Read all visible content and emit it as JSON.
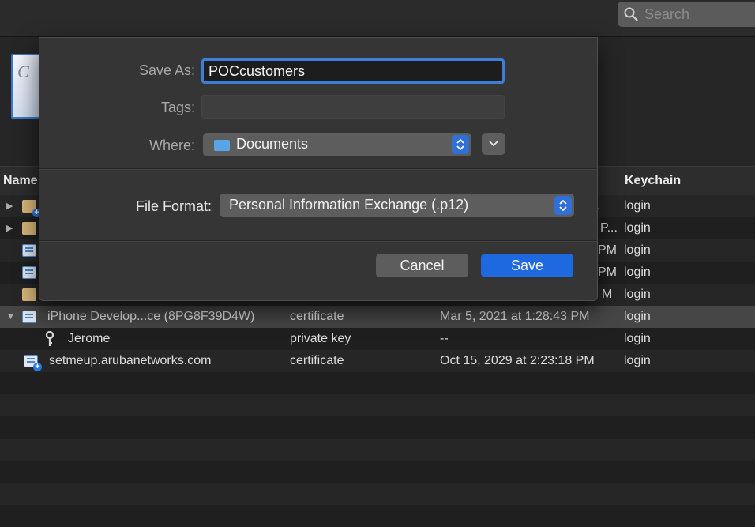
{
  "toolbar": {
    "search_placeholder": "Search"
  },
  "certificate_thumbnail": {
    "glyph": "C"
  },
  "table": {
    "columns": {
      "name": "Name",
      "keychain": "Keychain"
    },
    "rows": [
      {
        "visible_date_tail": ".",
        "keychain": "login",
        "icon": "folder-cert-icon",
        "disclosure": "collapsed"
      },
      {
        "visible_date_tail": "P...",
        "keychain": "login",
        "icon": "folder-icon",
        "disclosure": "collapsed"
      },
      {
        "visible_date_tail": "PM",
        "keychain": "login",
        "icon": "certificate-icon"
      },
      {
        "visible_date_tail": "PM",
        "keychain": "login",
        "icon": "certificate-icon"
      },
      {
        "visible_date_tail": "M",
        "keychain": "login",
        "icon": "folder-icon"
      },
      {
        "name": "iPhone Develop...ce (8PG8F39D4W)",
        "kind": "certificate",
        "date": "Mar 5, 2021 at 1:28:43 PM",
        "keychain": "login",
        "icon": "certificate-icon",
        "disclosure": "expanded",
        "selected": true
      },
      {
        "name": "Jerome",
        "kind": "private key",
        "date": "--",
        "keychain": "login",
        "icon": "key-icon"
      },
      {
        "name": "setmeup.arubanetworks.com",
        "kind": "certificate",
        "date": "Oct 15, 2029 at 2:23:18 PM",
        "keychain": "login",
        "icon": "certificate-plus-icon"
      }
    ]
  },
  "dialog": {
    "save_as_label": "Save As:",
    "save_as_value": "POCcustomers",
    "tags_label": "Tags:",
    "tags_value": "",
    "where_label": "Where:",
    "where_value": "Documents",
    "file_format_label": "File Format:",
    "file_format_value": "Personal Information Exchange (.p12)",
    "cancel_label": "Cancel",
    "save_label": "Save"
  },
  "colors": {
    "accent": "#1e69e0",
    "focus_ring": "#3d7fd6"
  }
}
